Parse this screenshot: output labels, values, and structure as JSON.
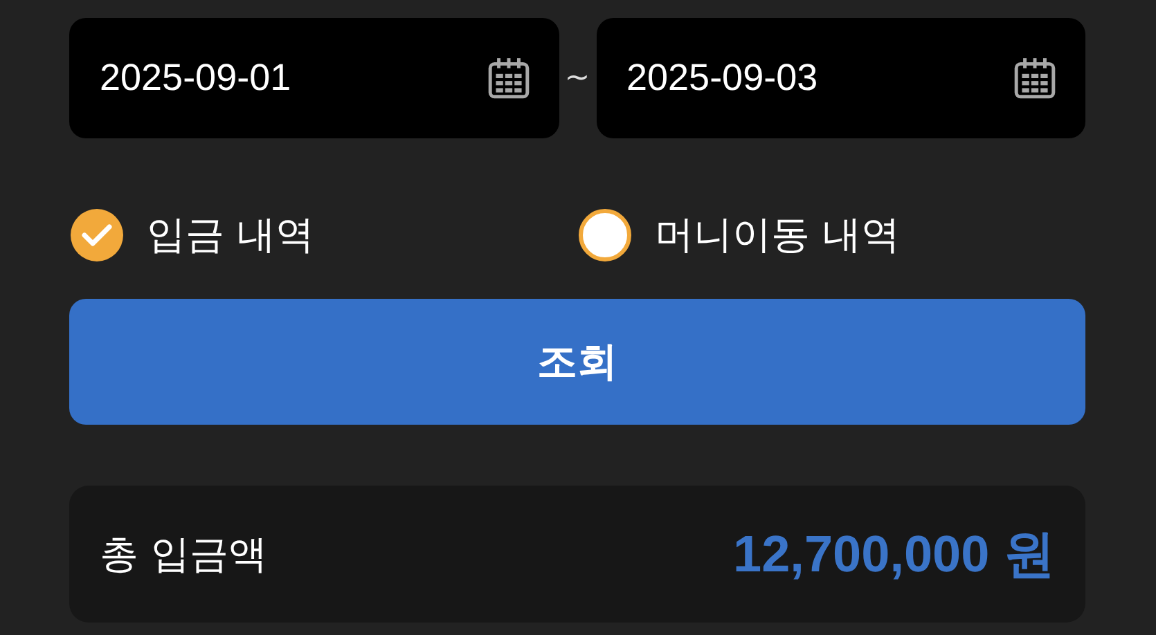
{
  "date_range": {
    "start": "2025-09-01",
    "separator": "~",
    "end": "2025-09-03"
  },
  "filters": [
    {
      "label": "입금 내역",
      "selected": true
    },
    {
      "label": "머니이동 내역",
      "selected": false
    }
  ],
  "search_button": "조회",
  "total": {
    "label": "총 입금액",
    "amount": "12,700,000 원"
  }
}
